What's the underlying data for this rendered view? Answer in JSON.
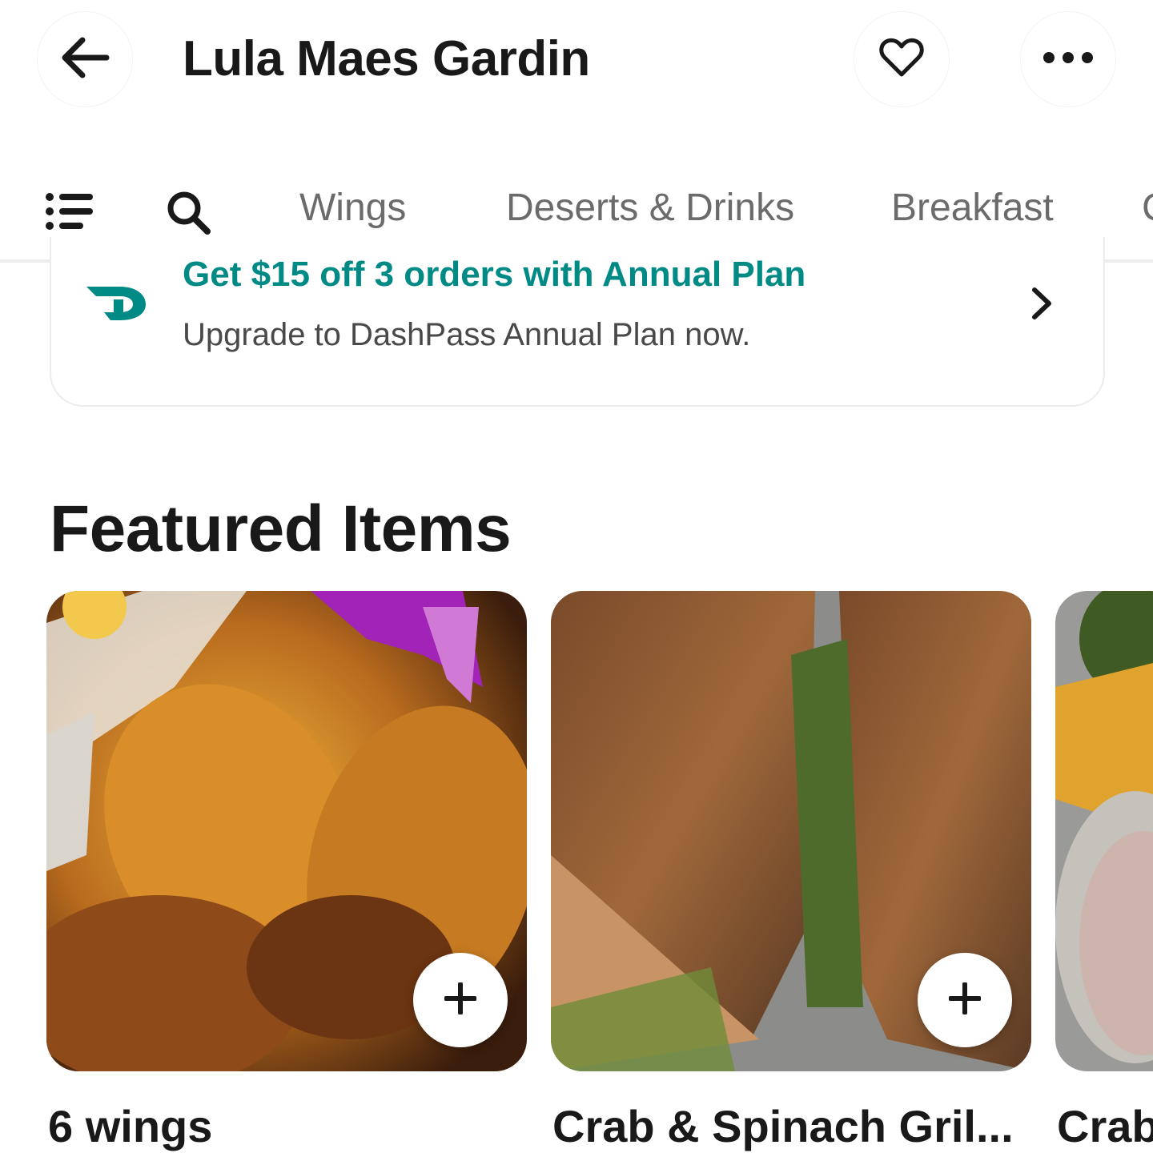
{
  "header": {
    "title": "Lula Maes Gardin",
    "back_icon": "arrow-left-icon",
    "favorite_icon": "heart-icon",
    "more_icon": "more-horizontal-icon"
  },
  "tabs": {
    "menu_icon": "list-icon",
    "search_icon": "search-icon",
    "items": [
      {
        "label": "Wings"
      },
      {
        "label": "Deserts & Drinks"
      },
      {
        "label": "Breakfast"
      },
      {
        "label": "C"
      }
    ]
  },
  "banner": {
    "title": "Get $15 off 3 orders with Annual Plan",
    "subtitle": "Upgrade to DashPass Annual Plan now.",
    "logo_icon": "dashpass-logo-icon",
    "chevron_icon": "chevron-right-icon"
  },
  "featured": {
    "title": "Featured Items",
    "items": [
      {
        "name": "6 wings",
        "add_icon": "plus-icon"
      },
      {
        "name": "Crab & Spinach Gril...",
        "add_icon": "plus-icon"
      },
      {
        "name": "Crab"
      }
    ]
  },
  "colors": {
    "accent": "#008a86",
    "text_primary": "#191919",
    "text_secondary": "#6b6b6b"
  }
}
